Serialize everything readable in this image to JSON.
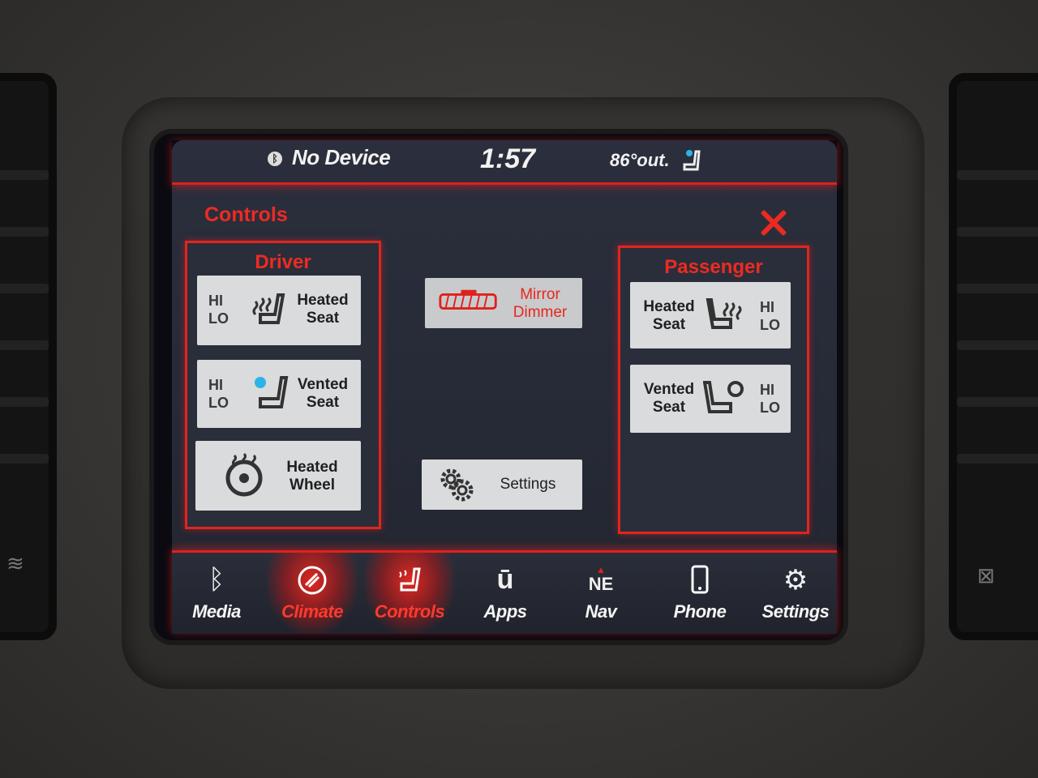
{
  "status": {
    "device": "No Device",
    "time": "1:57",
    "temperature": "86°out."
  },
  "screen_title": "Controls",
  "driver": {
    "title": "Driver",
    "heated_seat": {
      "hi": "HI",
      "lo": "LO",
      "label_line1": "Heated",
      "label_line2": "Seat"
    },
    "vented_seat": {
      "hi": "HI",
      "lo": "LO",
      "label_line1": "Vented",
      "label_line2": "Seat"
    },
    "heated_wheel": {
      "label_line1": "Heated",
      "label_line2": "Wheel"
    }
  },
  "center": {
    "mirror_dimmer": {
      "label_line1": "Mirror",
      "label_line2": "Dimmer"
    },
    "settings": {
      "label": "Settings"
    }
  },
  "passenger": {
    "title": "Passenger",
    "heated_seat": {
      "hi": "HI",
      "lo": "LO",
      "label_line1": "Heated",
      "label_line2": "Seat"
    },
    "vented_seat": {
      "hi": "HI",
      "lo": "LO",
      "label_line1": "Vented",
      "label_line2": "Seat"
    }
  },
  "nav": [
    {
      "label": "Media",
      "icon": "bluetooth-icon",
      "active": false
    },
    {
      "label": "Climate",
      "icon": "climate-icon",
      "active": true
    },
    {
      "label": "Controls",
      "icon": "seat-controls-icon",
      "active": true
    },
    {
      "label": "Apps",
      "icon": "apps-icon",
      "active": false
    },
    {
      "label": "Nav",
      "icon": "compass-icon",
      "compass": "NE",
      "active": false
    },
    {
      "label": "Phone",
      "icon": "phone-icon",
      "active": false
    },
    {
      "label": "Settings",
      "icon": "gear-icon",
      "active": false
    }
  ],
  "colors": {
    "accent_red": "#e0201d",
    "vent_blue": "#2bb3e8",
    "tile_gray": "#dadbdc"
  }
}
